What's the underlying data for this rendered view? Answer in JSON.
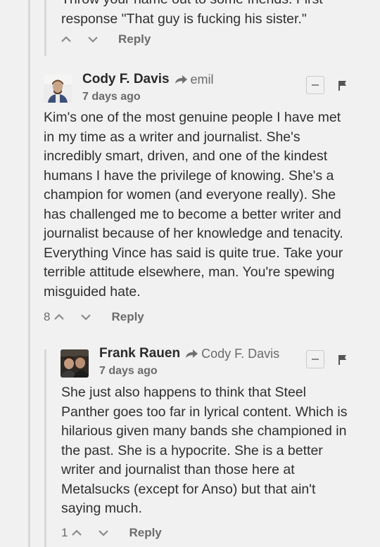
{
  "comment0": {
    "body_line1": "Throw your name out to some friends. First",
    "body_line2": "response \"That guy is fucking his sister.\"",
    "reply_label": "Reply"
  },
  "comment1": {
    "author": "Cody F. Davis",
    "reply_to": "emil",
    "time": "7 days ago",
    "body": "Kim's one of the most genuine people I have met in my time as a writer and journalist. She's incredibly smart, driven, and one of the kindest humans I have the privilege of knowing. She's a champion for women (and everyone really). She has challenged me to become a better writer and journalist because of her knowledge and tenacity. Everything Vince has said is quite true. Take your terrible attitude elsewhere, man. You're spewing misguided hate.",
    "votes": "8",
    "reply_label": "Reply"
  },
  "comment2": {
    "author": "Frank Rauen",
    "reply_to": "Cody F. Davis",
    "time": "7 days ago",
    "body": "She just also happens to think that Steel Panther goes too far in lyrical content. Which is hilarious given many bands she championed in the past. She is a hypocrite. She is a better writer and journalist than those here at Metalsucks (except for Anso) but that ain't saying much.",
    "votes": "1",
    "reply_label": "Reply"
  },
  "icons": {
    "reply_arrow": "share-arrow-icon",
    "collapse": "minus-icon",
    "flag": "flag-icon",
    "upvote": "chevron-up-icon",
    "downvote": "chevron-down-icon"
  },
  "colors": {
    "background": "#f1f1f1",
    "thread_line": "#d8d8d8",
    "text": "#2f2f2f",
    "muted": "#6b6b6b"
  }
}
